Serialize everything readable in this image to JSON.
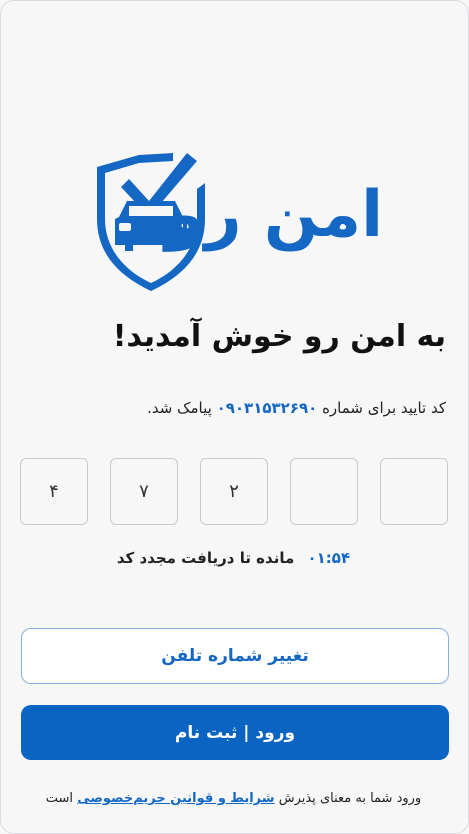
{
  "brand": {
    "name": "امن رو",
    "color": "#1468c4"
  },
  "header": {
    "title": "به امن رو خوش آمدید!",
    "subtitle_prefix": "کد تایید برای شماره",
    "phone": "۰۹۰۳۱۵۳۲۶۹۰",
    "subtitle_suffix": "پیامک شد."
  },
  "otp": {
    "digits": [
      "",
      "",
      "۲",
      "۷",
      "۴"
    ]
  },
  "timer": {
    "time": "۰۱:۵۴",
    "label": "مانده تا دریافت مجدد کد"
  },
  "actions": {
    "change_phone_label": "تغییر شماره تلفن",
    "submit_label": "ورود | ثبت نام"
  },
  "footer": {
    "prefix": "ورود شما به معنای پذیرش",
    "link_label": "شرایط و قوانین حریم‌خصوصی",
    "suffix": "است"
  },
  "colors": {
    "primary": "#0a64c2",
    "background": "#f7f7f8"
  }
}
